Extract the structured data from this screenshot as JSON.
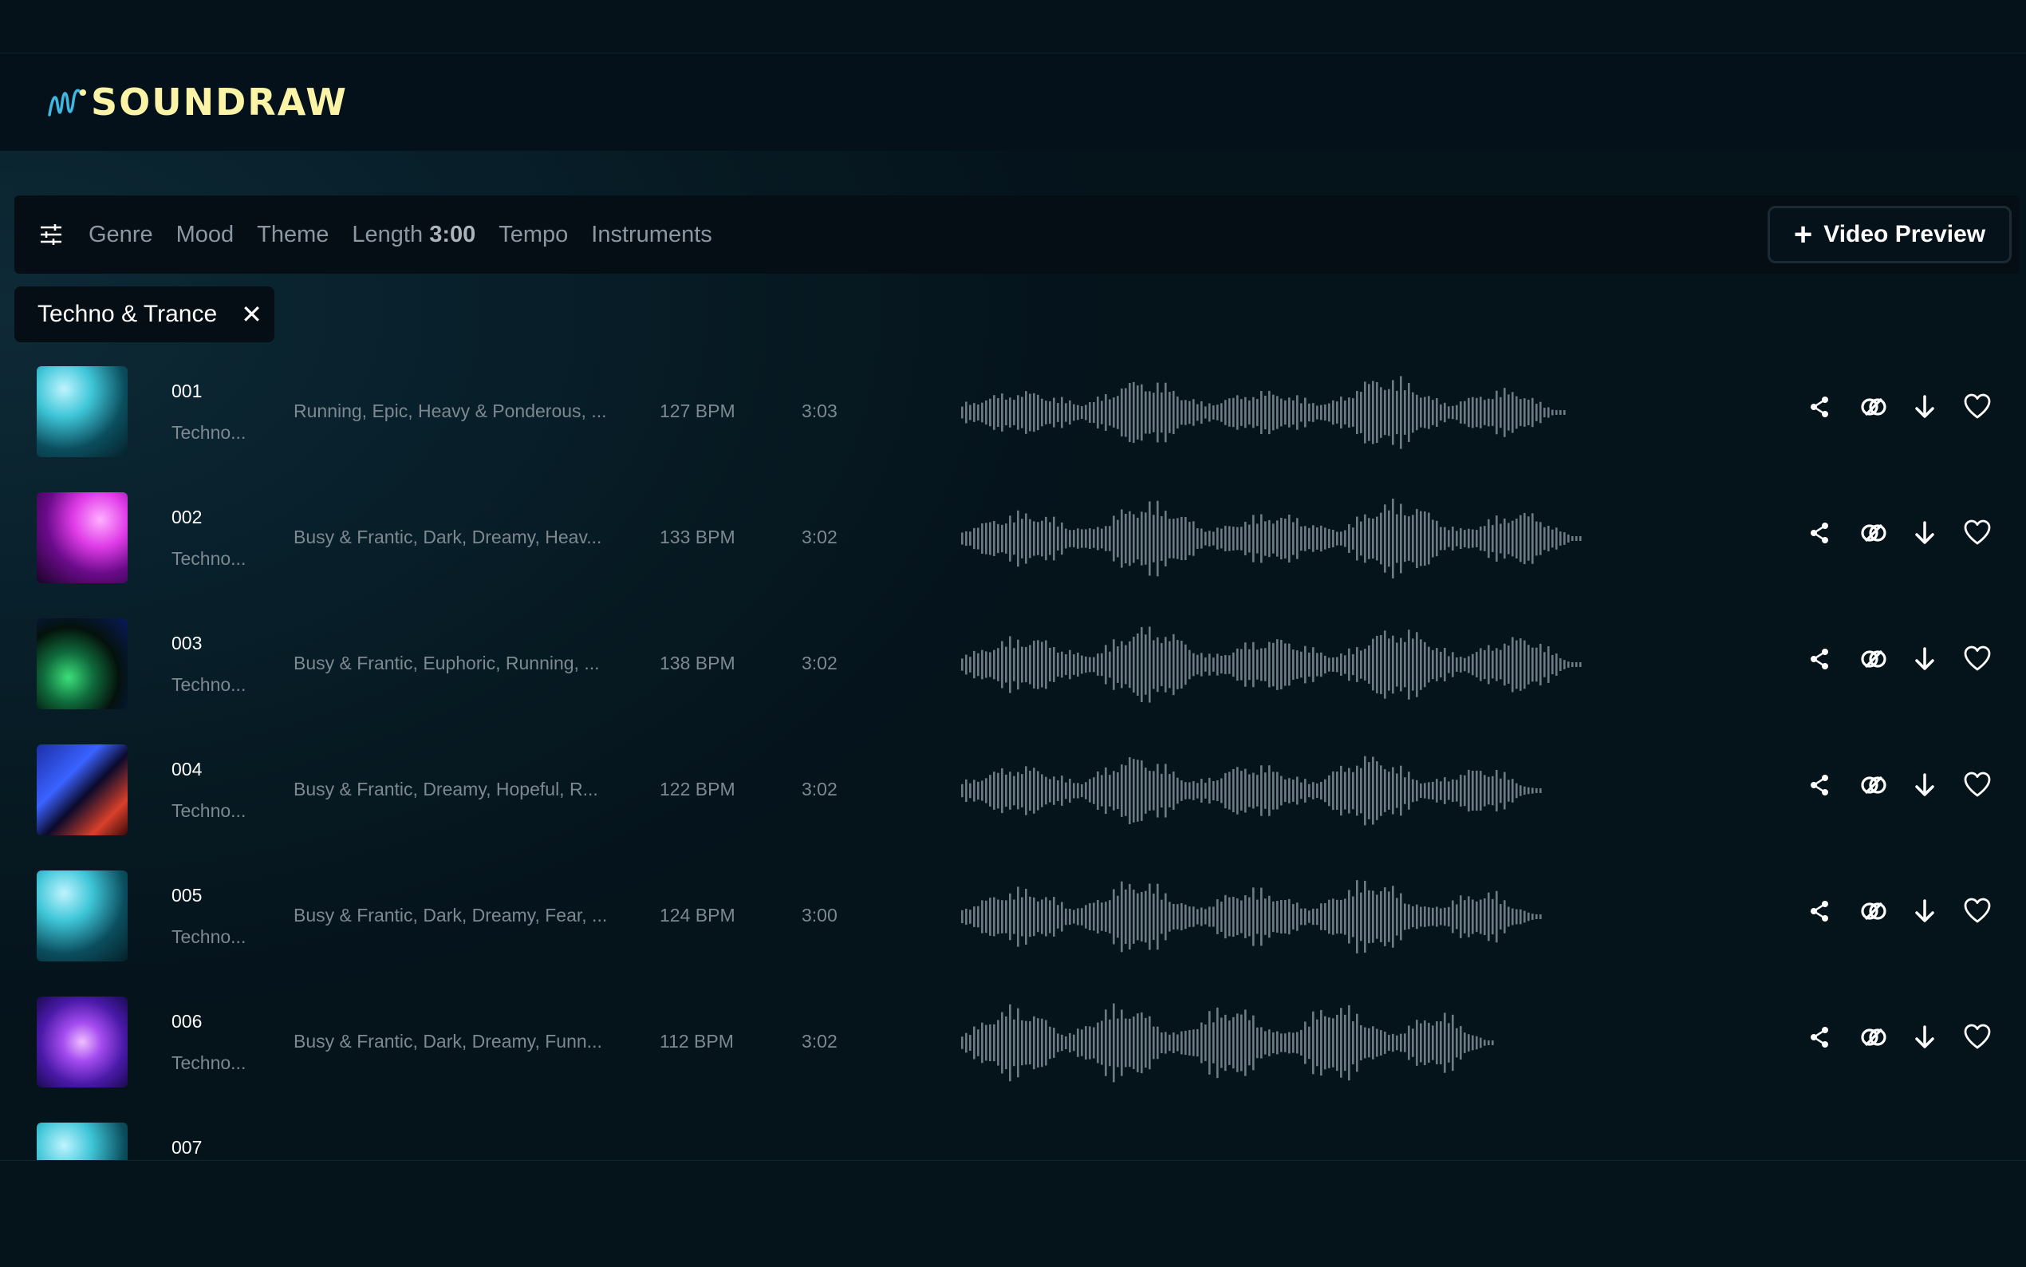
{
  "app": {
    "logo_text": "SOUNDRAW"
  },
  "filters": {
    "items": [
      {
        "label": "Genre"
      },
      {
        "label": "Mood"
      },
      {
        "label": "Theme"
      },
      {
        "label": "Length ",
        "value": "3:00"
      },
      {
        "label": "Tempo"
      },
      {
        "label": "Instruments"
      }
    ],
    "video_preview_label": "Video Preview"
  },
  "active_filter_chip": "Techno & Trance",
  "colors": {
    "accent": "#fbf3a6",
    "background": "#06121a",
    "text_muted": "#7d8891"
  },
  "tracks": [
    {
      "number": "001",
      "genre": "Techno...",
      "tags": "Running, Epic, Heavy & Ponderous, ...",
      "bpm": "127 BPM",
      "duration": "3:03",
      "thumb": "crowd-cyan"
    },
    {
      "number": "002",
      "genre": "Techno...",
      "tags": "Busy & Frantic, Dark, Dreamy, Heav...",
      "bpm": "133 BPM",
      "duration": "3:02",
      "thumb": "magenta-stage"
    },
    {
      "number": "003",
      "genre": "Techno...",
      "tags": "Busy & Frantic, Euphoric, Running, ...",
      "bpm": "138 BPM",
      "duration": "3:02",
      "thumb": "green-lights"
    },
    {
      "number": "004",
      "genre": "Techno...",
      "tags": "Busy & Frantic, Dreamy, Hopeful, R...",
      "bpm": "122 BPM",
      "duration": "3:02",
      "thumb": "club-red-blue"
    },
    {
      "number": "005",
      "genre": "Techno...",
      "tags": "Busy & Frantic, Dark, Dreamy, Fear, ...",
      "bpm": "124 BPM",
      "duration": "3:00",
      "thumb": "crowd-cyan"
    },
    {
      "number": "006",
      "genre": "Techno...",
      "tags": "Busy & Frantic, Dark, Dreamy, Funn...",
      "bpm": "112 BPM",
      "duration": "3:02",
      "thumb": "purple-concert"
    },
    {
      "number": "007",
      "genre": "",
      "tags": "",
      "bpm": "",
      "duration": "",
      "thumb": "crowd-cyan"
    }
  ],
  "row_actions": [
    "share-icon",
    "link-icon",
    "download-icon",
    "heart-icon"
  ]
}
